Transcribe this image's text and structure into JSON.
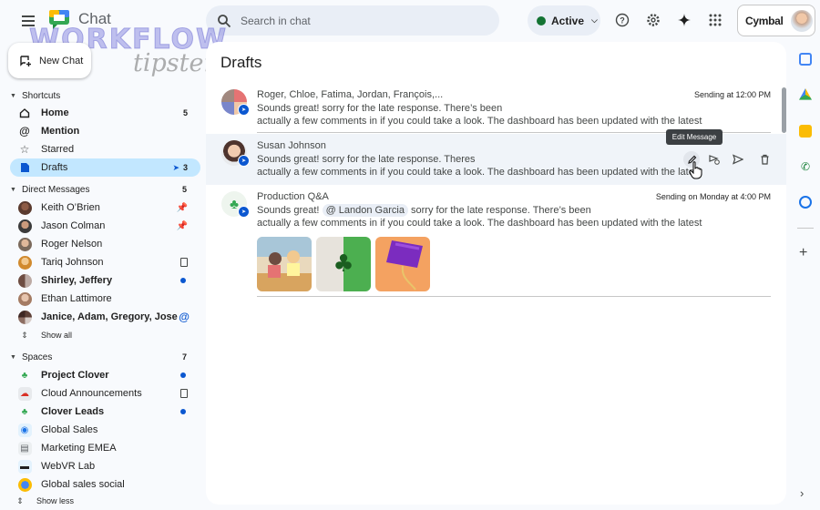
{
  "app": {
    "name": "Chat",
    "brand": "Cymbal"
  },
  "search": {
    "placeholder": "Search in chat"
  },
  "status": {
    "label": "Active",
    "color": "#137333"
  },
  "toolbar_icons": [
    "help-icon",
    "settings-icon",
    "gemini-sparkle-icon",
    "apps-grid-icon"
  ],
  "watermark": {
    "line1": "WORKFLOW",
    "line2": "tipster.top"
  },
  "new_chat": {
    "label": "New Chat"
  },
  "sidebar": {
    "shortcuts": {
      "title": "Shortcuts",
      "items": [
        {
          "label": "Home",
          "icon": "home-icon",
          "badge": "5"
        },
        {
          "label": "Mention",
          "icon": "at-icon"
        },
        {
          "label": "Starred",
          "icon": "star-icon"
        },
        {
          "label": "Drafts",
          "icon": "draft-icon",
          "badge": "3",
          "active": true
        }
      ]
    },
    "direct_messages": {
      "title": "Direct Messages",
      "count": "5",
      "items": [
        {
          "label": "Keith O’Brien",
          "marker": "pin"
        },
        {
          "label": "Jason Colman",
          "marker": "pin"
        },
        {
          "label": "Roger Nelson"
        },
        {
          "label": "Tariq Johnson",
          "marker": "doc"
        },
        {
          "label": "Shirley, Jeffery",
          "bold": true,
          "marker": "dot"
        },
        {
          "label": "Ethan Lattimore"
        },
        {
          "label": "Janice, Adam, Gregory, Jose...",
          "bold": true,
          "marker": "at"
        },
        {
          "label": "Show all"
        }
      ]
    },
    "spaces": {
      "title": "Spaces",
      "count": "7",
      "items": [
        {
          "label": "Project Clover",
          "bold": true,
          "marker": "dot"
        },
        {
          "label": "Cloud Announcements",
          "marker": "doc"
        },
        {
          "label": "Clover Leads",
          "bold": true,
          "marker": "dot"
        },
        {
          "label": "Global Sales"
        },
        {
          "label": "Marketing EMEA"
        },
        {
          "label": "WebVR Lab"
        },
        {
          "label": "Global sales social"
        }
      ],
      "show_less": "Show less"
    }
  },
  "main": {
    "title": "Drafts",
    "drafts": [
      {
        "names": "Roger, Chloe, Fatima, Jordan, François,...",
        "time": "Sending at 12:00 PM",
        "line1": "Sounds great! sorry for the late response. There’s been",
        "line2": "actually a few comments in if you could take a look. The dashboard has been updated with the latest"
      },
      {
        "names": "Susan Johnson",
        "line1": "Sounds great! sorry for the late response. Theres",
        "line2": "actually a few comments in if you could take a look. The dashboard has been updated with the latest",
        "tooltip": "Edit Message"
      },
      {
        "names": "Production Q&A",
        "time": "Sending on Monday at 4:00 PM",
        "line1_pre": "Sounds great!",
        "mention": "@ Landon Garcia",
        "line1_post": "sorry for the late response. There’s been",
        "line2": "actually a few comments in if you could take a look. The dashboard has been updated with the latest"
      }
    ]
  },
  "right_rail": [
    "calendar-icon",
    "drive-icon",
    "keep-icon",
    "voice-icon",
    "tasks-icon"
  ],
  "colors": {
    "accent": "#0b57d0",
    "active_bg": "#c2e7ff",
    "bg": "#f8fafd"
  }
}
